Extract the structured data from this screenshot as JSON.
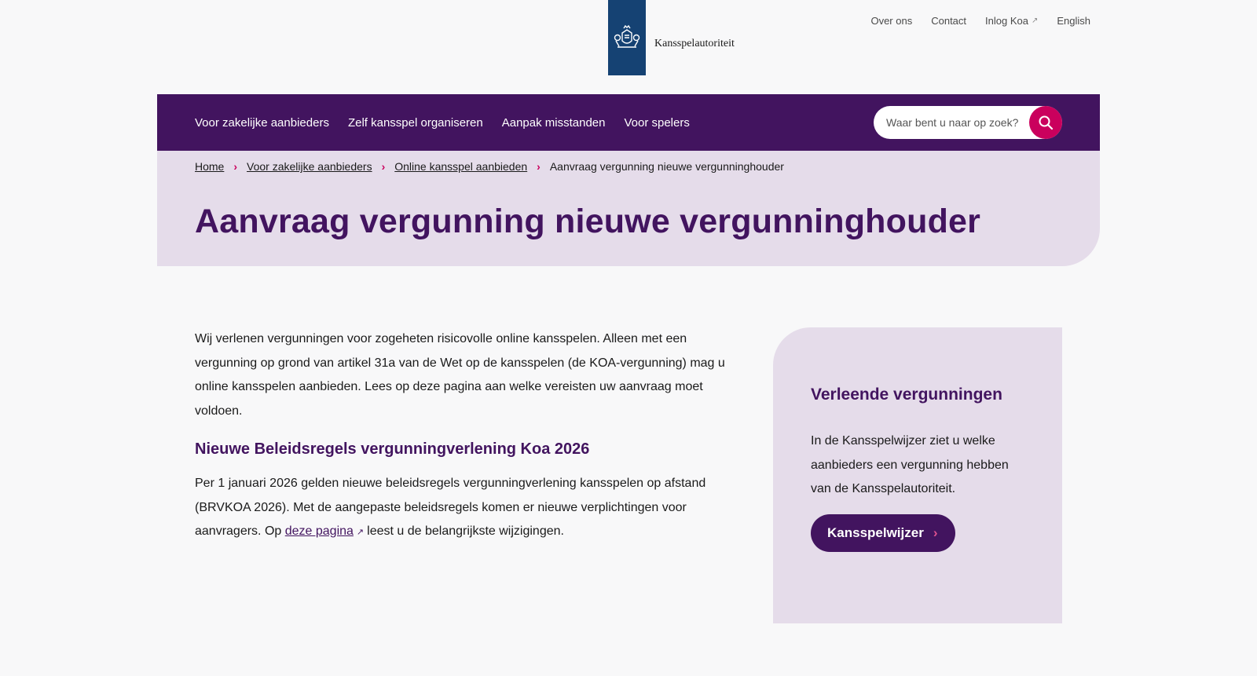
{
  "header": {
    "logo_text": "Kansspelautoriteit",
    "top_links": [
      {
        "label": "Over ons"
      },
      {
        "label": "Contact"
      },
      {
        "label": "Inlog Koa",
        "external": true
      },
      {
        "label": "English"
      }
    ]
  },
  "nav": {
    "items": [
      {
        "label": "Voor zakelijke aanbieders"
      },
      {
        "label": "Zelf kansspel organiseren"
      },
      {
        "label": "Aanpak misstanden"
      },
      {
        "label": "Voor spelers"
      }
    ],
    "search_placeholder": "Waar bent u naar op zoek?",
    "search_icon": "search-icon"
  },
  "breadcrumb": {
    "items": [
      {
        "label": "Home"
      },
      {
        "label": "Voor zakelijke aanbieders"
      },
      {
        "label": "Online kansspel aanbieden"
      }
    ],
    "current": "Aanvraag vergunning nieuwe vergunninghouder"
  },
  "page": {
    "title": "Aanvraag vergunning nieuwe vergunninghouder"
  },
  "main": {
    "intro": "Wij verlenen vergunningen voor zogeheten risicovolle online kansspelen. Alleen met een vergunning op grond van artikel 31a van de Wet op de kansspelen (de KOA-vergunning) mag u online kansspelen aanbieden. Lees op deze pagina aan welke vereisten uw aanvraag moet voldoen.",
    "section_heading": "Nieuwe Beleidsregels vergunningverlening Koa 2026",
    "section_text_before": "Per 1 januari 2026 gelden nieuwe beleidsregels vergunningverlening kansspelen op afstand (BRVKOA 2026). Met de aangepaste beleidsregels komen er nieuwe verplichtingen voor aanvragers. Op ",
    "section_link": "deze pagina",
    "section_text_after": "leest u de belangrijkste wijzigingen."
  },
  "aside": {
    "heading": "Verleende vergunningen",
    "text": "In de Kansspelwijzer ziet u welke aanbieders een vergunning hebben van de Kansspelautoriteit.",
    "button_label": "Kansspelwijzer"
  },
  "colors": {
    "brand_purple": "#42145f",
    "accent_pink": "#ca005d",
    "light_lilac": "#e5dcea",
    "logo_blue": "#154273"
  }
}
